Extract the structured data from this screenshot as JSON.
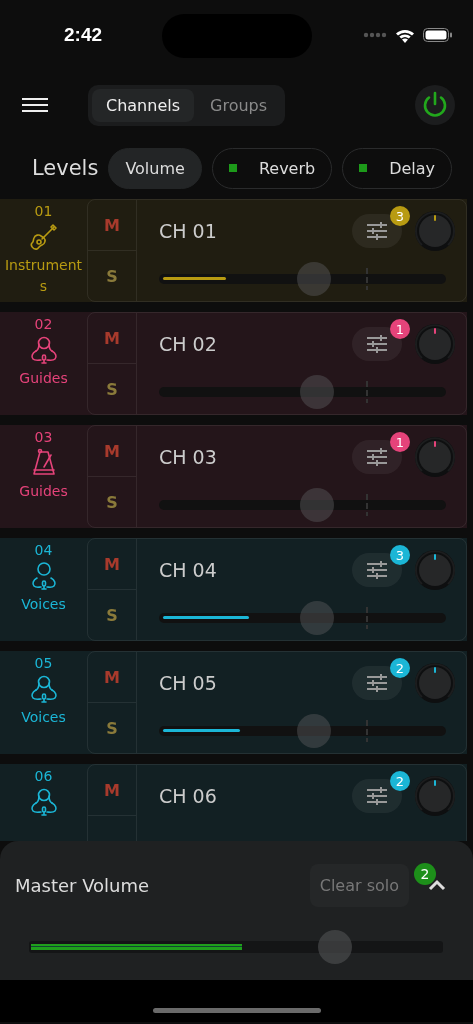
{
  "status_bar": {
    "time": "2:42"
  },
  "tabs": [
    {
      "label": "Channels",
      "selected": true
    },
    {
      "label": "Groups",
      "selected": false
    }
  ],
  "power": {
    "on": true
  },
  "levels": {
    "label": "Levels",
    "options": [
      {
        "label": "Volume",
        "selected": true,
        "active": false
      },
      {
        "label": "Reverb",
        "selected": false,
        "active": true
      },
      {
        "label": "Delay",
        "selected": false,
        "active": true
      }
    ]
  },
  "channels": [
    {
      "number": "01",
      "group": "Instruments",
      "kind": "guitar",
      "color": "#b89b12",
      "name": "CH 01",
      "mute": "M",
      "solo": "S",
      "effects_count": "3",
      "meter": {
        "level": 0.22
      },
      "fader": {
        "level": 0.54
      }
    },
    {
      "number": "02",
      "group": "Guides",
      "kind": "singer",
      "color": "#e5437a",
      "name": "CH 02",
      "mute": "M",
      "solo": "S",
      "effects_count": "1",
      "fader": {
        "level": 0.55
      }
    },
    {
      "number": "03",
      "group": "Guides",
      "kind": "metronome",
      "color": "#e5437a",
      "name": "CH 03",
      "mute": "M",
      "solo": "S",
      "effects_count": "1",
      "fader": {
        "level": 0.55
      }
    },
    {
      "number": "04",
      "group": "Voices",
      "kind": "person",
      "color": "#1bb6d6",
      "name": "CH 04",
      "mute": "M",
      "solo": "S",
      "effects_count": "3",
      "meter": {
        "level": 0.3
      },
      "fader": {
        "level": 0.55
      }
    },
    {
      "number": "05",
      "group": "Voices",
      "kind": "singer",
      "color": "#1bb6d6",
      "name": "CH 05",
      "mute": "M",
      "solo": "S",
      "effects_count": "2",
      "meter": {
        "level": 0.27
      },
      "fader": {
        "level": 0.54
      }
    },
    {
      "number": "06",
      "kind": "singer",
      "color": "#1bb6d6",
      "name": "CH 06",
      "mute": "M",
      "effects_count": "2"
    }
  ],
  "master": {
    "title": "Master Volume",
    "clear_button": "Clear solo",
    "count": "2",
    "meter": {
      "level": 0.51
    },
    "fader": {
      "level": 0.74
    }
  }
}
